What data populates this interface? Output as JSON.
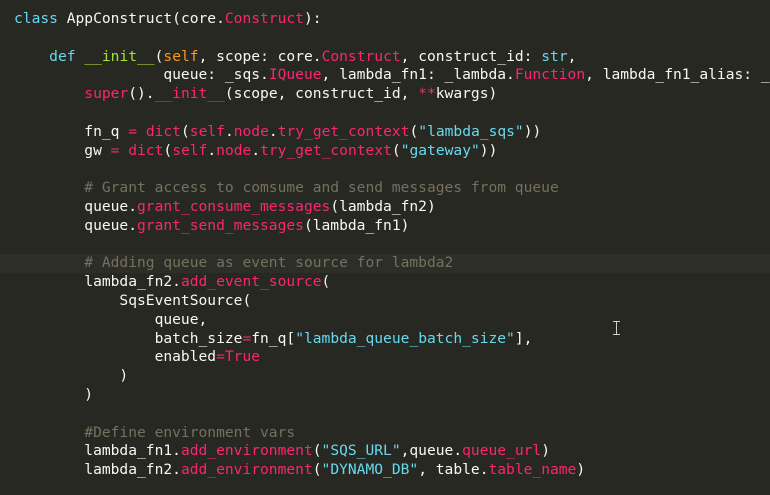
{
  "lines": [
    [
      {
        "t": "class ",
        "c": "kw"
      },
      {
        "t": "AppConstruct",
        "c": "name"
      },
      {
        "t": "(core.",
        "c": "name"
      },
      {
        "t": "Construct",
        "c": "err"
      },
      {
        "t": "):",
        "c": "name"
      }
    ],
    [],
    [
      {
        "t": "    ",
        "c": "name"
      },
      {
        "t": "def ",
        "c": "kw"
      },
      {
        "t": "__init__",
        "c": "fn"
      },
      {
        "t": "(",
        "c": "name"
      },
      {
        "t": "self",
        "c": "param"
      },
      {
        "t": ", scope: core.",
        "c": "name"
      },
      {
        "t": "Construct",
        "c": "err"
      },
      {
        "t": ", construct_id: ",
        "c": "name"
      },
      {
        "t": "str",
        "c": "kw"
      },
      {
        "t": ",",
        "c": "name"
      }
    ],
    [
      {
        "t": "                 queue: _sqs.",
        "c": "name"
      },
      {
        "t": "IQueue",
        "c": "err"
      },
      {
        "t": ", lambda_fn1: _lambda.",
        "c": "name"
      },
      {
        "t": "Function",
        "c": "err"
      },
      {
        "t": ", lambda_fn1_alias: _",
        "c": "name"
      }
    ],
    [
      {
        "t": "        ",
        "c": "name"
      },
      {
        "t": "super",
        "c": "err"
      },
      {
        "t": "().",
        "c": "name"
      },
      {
        "t": "__init__",
        "c": "err"
      },
      {
        "t": "(scope, construct_id, ",
        "c": "name"
      },
      {
        "t": "**",
        "c": "err"
      },
      {
        "t": "kwargs)",
        "c": "name"
      }
    ],
    [],
    [
      {
        "t": "        fn_q ",
        "c": "name"
      },
      {
        "t": "=",
        "c": "err"
      },
      {
        "t": " ",
        "c": "name"
      },
      {
        "t": "dict",
        "c": "err"
      },
      {
        "t": "(",
        "c": "name"
      },
      {
        "t": "self",
        "c": "err"
      },
      {
        "t": ".",
        "c": "name"
      },
      {
        "t": "node",
        "c": "err"
      },
      {
        "t": ".",
        "c": "name"
      },
      {
        "t": "try_get_context",
        "c": "err"
      },
      {
        "t": "(",
        "c": "name"
      },
      {
        "t": "\"lambda_sqs\"",
        "c": "str2"
      },
      {
        "t": "))",
        "c": "name"
      }
    ],
    [
      {
        "t": "        gw ",
        "c": "name"
      },
      {
        "t": "=",
        "c": "err"
      },
      {
        "t": " ",
        "c": "name"
      },
      {
        "t": "dict",
        "c": "err"
      },
      {
        "t": "(",
        "c": "name"
      },
      {
        "t": "self",
        "c": "err"
      },
      {
        "t": ".",
        "c": "name"
      },
      {
        "t": "node",
        "c": "err"
      },
      {
        "t": ".",
        "c": "name"
      },
      {
        "t": "try_get_context",
        "c": "err"
      },
      {
        "t": "(",
        "c": "name"
      },
      {
        "t": "\"gateway\"",
        "c": "str2"
      },
      {
        "t": "))",
        "c": "name"
      }
    ],
    [],
    [
      {
        "t": "        # Grant access to comsume and send messages from queue",
        "c": "cmt"
      }
    ],
    [
      {
        "t": "        queue.",
        "c": "name"
      },
      {
        "t": "grant_consume_messages",
        "c": "err"
      },
      {
        "t": "(lambda_fn2)",
        "c": "name"
      }
    ],
    [
      {
        "t": "        queue.",
        "c": "name"
      },
      {
        "t": "grant_send_messages",
        "c": "err"
      },
      {
        "t": "(lambda_fn1)",
        "c": "name"
      }
    ],
    [],
    [
      {
        "t": "        # Adding queue as event source for lambda2",
        "c": "cmt"
      }
    ],
    [
      {
        "t": "        lambda_fn2.",
        "c": "name"
      },
      {
        "t": "add_event_source",
        "c": "err"
      },
      {
        "t": "(",
        "c": "name"
      }
    ],
    [
      {
        "t": "            SqsEventSource(",
        "c": "name"
      }
    ],
    [
      {
        "t": "                queue,",
        "c": "name"
      }
    ],
    [
      {
        "t": "                batch_size",
        "c": "name"
      },
      {
        "t": "=",
        "c": "err"
      },
      {
        "t": "fn_q[",
        "c": "name"
      },
      {
        "t": "\"lambda_queue_batch_size\"",
        "c": "str2"
      },
      {
        "t": "],",
        "c": "name"
      }
    ],
    [
      {
        "t": "                enabled",
        "c": "name"
      },
      {
        "t": "=",
        "c": "err"
      },
      {
        "t": "True",
        "c": "err"
      }
    ],
    [
      {
        "t": "            )",
        "c": "name"
      }
    ],
    [
      {
        "t": "        )",
        "c": "name"
      }
    ],
    [],
    [
      {
        "t": "        #Define environment vars",
        "c": "cmt"
      }
    ],
    [
      {
        "t": "        lambda_fn1.",
        "c": "name"
      },
      {
        "t": "add_environment",
        "c": "err"
      },
      {
        "t": "(",
        "c": "name"
      },
      {
        "t": "\"SQS_URL\"",
        "c": "str2"
      },
      {
        "t": ",queue.",
        "c": "name"
      },
      {
        "t": "queue_url",
        "c": "err"
      },
      {
        "t": ")",
        "c": "name"
      }
    ],
    [
      {
        "t": "        lambda_fn2.",
        "c": "name"
      },
      {
        "t": "add_environment",
        "c": "err"
      },
      {
        "t": "(",
        "c": "name"
      },
      {
        "t": "\"DYNAMO_DB\"",
        "c": "str2"
      },
      {
        "t": ", table.",
        "c": "name"
      },
      {
        "t": "table_name",
        "c": "err"
      },
      {
        "t": ")",
        "c": "name"
      }
    ]
  ],
  "current_line": 13
}
